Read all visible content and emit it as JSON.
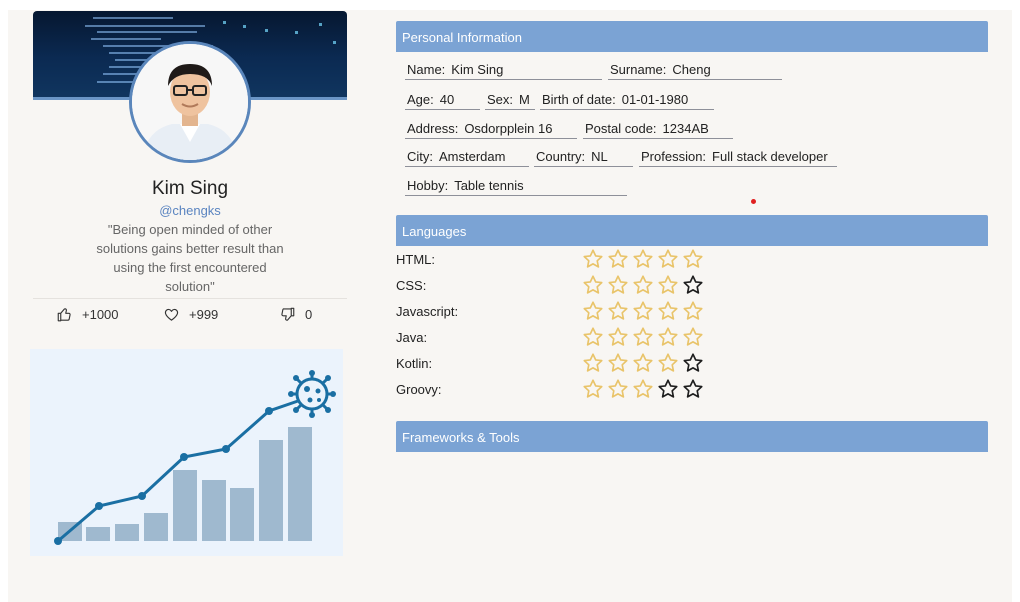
{
  "profile": {
    "name": "Kim Sing",
    "handle": "@chengks",
    "quote": "\"Being open minded of other solutions gains better result than using the first encountered solution\"",
    "stats": {
      "likes": "+1000",
      "favorites": "+999",
      "dislikes": "0"
    }
  },
  "personal": {
    "title": "Personal Information",
    "name_label": "Name:",
    "name_value": "Kim Sing",
    "surname_label": "Surname:",
    "surname_value": "Cheng",
    "age_label": "Age:",
    "age_value": "40",
    "sex_label": "Sex:",
    "sex_value": "M",
    "birth_label": "Birth of date:",
    "birth_value": "01-01-1980",
    "address_label": "Address:",
    "address_value": "Osdorpplein 16",
    "postal_label": "Postal code:",
    "postal_value": "1234AB",
    "city_label": "City:",
    "city_value": "Amsterdam",
    "country_label": "Country:",
    "country_value": "NL",
    "profession_label": "Profession:",
    "profession_value": "Full stack developer",
    "hobby_label": "Hobby:",
    "hobby_value": "Table tennis"
  },
  "languages": {
    "title": "Languages",
    "items": [
      {
        "name": "HTML:",
        "rating": 5
      },
      {
        "name": "CSS:",
        "rating": 4
      },
      {
        "name": "Javascript:",
        "rating": 5
      },
      {
        "name": "Java:",
        "rating": 5
      },
      {
        "name": "Kotlin:",
        "rating": 4
      },
      {
        "name": "Groovy:",
        "rating": 3
      }
    ],
    "max_rating": 5,
    "star_filled_color": "#e9c46a",
    "star_empty_color": "#1e1e1e"
  },
  "frameworks": {
    "title": "Frameworks & Tools"
  },
  "colors": {
    "header_bg": "#7ba3d4",
    "accent": "#5a84c0",
    "chart_line": "#1a6fa3",
    "chart_bars": "#9fb9cf"
  }
}
